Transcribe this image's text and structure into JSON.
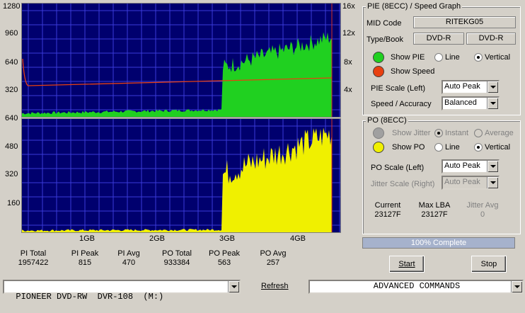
{
  "pie_graph": {
    "left_ticks": [
      "1280",
      "960",
      "640",
      "320"
    ],
    "right_ticks": [
      "16x",
      "12x",
      "8x",
      "4x"
    ]
  },
  "po_graph": {
    "left_ticks": [
      "640",
      "480",
      "320",
      "160"
    ],
    "x_ticks": [
      "1GB",
      "2GB",
      "3GB",
      "4GB"
    ]
  },
  "pie_panel": {
    "title": "PIE (8ECC) / Speed Graph",
    "mid_code_label": "MID Code",
    "mid_code_value": "RITEKG05",
    "type_book_label": "Type/Book",
    "type_value": "DVD-R",
    "book_value": "DVD-R",
    "show_pie_label": "Show PIE",
    "line_label": "Line",
    "vertical_label": "Vertical",
    "show_speed_label": "Show Speed",
    "pie_scale_label": "PIE Scale (Left)",
    "pie_scale_value": "Auto Peak",
    "speed_accuracy_label": "Speed / Accuracy",
    "speed_accuracy_value": "Balanced",
    "pie_color": "#20d020",
    "speed_color": "#e84010"
  },
  "po_panel": {
    "title": "PO (8ECC)",
    "show_jitter_label": "Show Jitter",
    "instant_label": "Instant",
    "average_label": "Average",
    "show_po_label": "Show PO",
    "line_label": "Line",
    "vertical_label": "Vertical",
    "po_scale_label": "PO Scale (Left)",
    "po_scale_value": "Auto Peak",
    "jitter_scale_label": "Jitter Scale (Right)",
    "jitter_scale_value": "Auto Peak",
    "current_label": "Current",
    "current_value": "23127F",
    "max_lba_label": "Max LBA",
    "max_lba_value": "23127F",
    "jitter_avg_label": "Jitter Avg",
    "jitter_avg_value": "0",
    "po_color": "#f0f000"
  },
  "progress": {
    "text": "100% Complete",
    "fraction": 1.0
  },
  "stats": [
    {
      "label": "PI Total",
      "value": "1957422"
    },
    {
      "label": "PI Peak",
      "value": "815"
    },
    {
      "label": "PI Avg",
      "value": "470"
    },
    {
      "label": "PO Total",
      "value": "933384"
    },
    {
      "label": "PO Peak",
      "value": "563"
    },
    {
      "label": "PO Avg",
      "value": "257"
    }
  ],
  "buttons": {
    "start": "Start",
    "stop": "Stop",
    "refresh": "Refresh"
  },
  "drive_select": "PIONEER DVD-RW  DVR-108  (M:)",
  "commands_select": "ADVANCED COMMANDS"
}
